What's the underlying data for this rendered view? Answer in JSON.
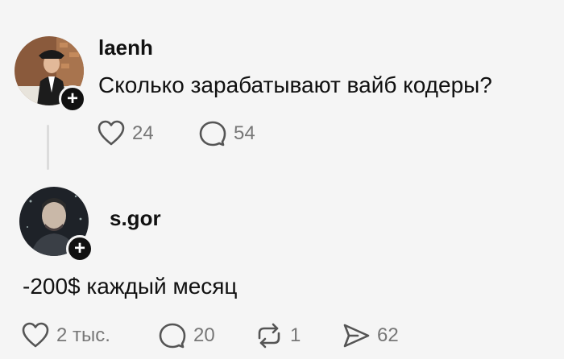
{
  "posts": [
    {
      "username": "laenh",
      "text": "Сколько зарабатывают вайб кодеры?",
      "actions": {
        "likes": "24",
        "replies": "54"
      }
    },
    {
      "username": "s.gor",
      "text": "-200$ каждый месяц",
      "actions": {
        "likes": "2 тыс.",
        "replies": "20",
        "reposts": "1",
        "shares": "62"
      }
    }
  ],
  "icons": {
    "follow": "plus-icon",
    "like": "heart-icon",
    "reply": "comment-icon",
    "repost": "repost-icon",
    "share": "send-icon"
  },
  "colors": {
    "background": "#f5f5f5",
    "text": "#111111",
    "muted": "#777777",
    "badge": "#111111"
  }
}
